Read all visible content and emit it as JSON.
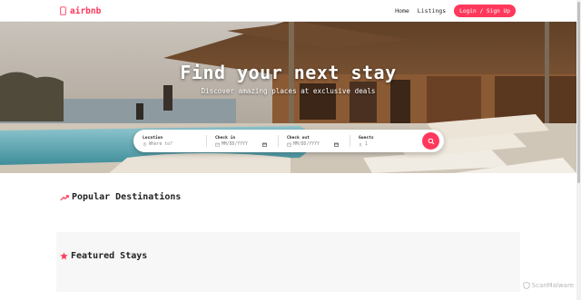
{
  "header": {
    "brand": "airbnb",
    "nav": {
      "home": "Home",
      "listings": "Listings",
      "login": "Login / Sign Up"
    }
  },
  "hero": {
    "title": "Find your next stay",
    "subtitle": "Discover amazing places at exclusive deals"
  },
  "search": {
    "location": {
      "label": "Location",
      "placeholder": "Where to?"
    },
    "checkin": {
      "label": "Check in",
      "value": "MM/DD/YYYY"
    },
    "checkout": {
      "label": "Check out",
      "value": "MM/DD/YYYY"
    },
    "guests": {
      "label": "Guests",
      "value": "1"
    }
  },
  "sections": {
    "popular": "Popular Destinations",
    "featured": "Featured Stays"
  },
  "watermark": "ScanMalware",
  "colors": {
    "brand": "#ff385c",
    "text": "#222222",
    "muted": "#888888"
  },
  "icons": {
    "brand": "airbnb-logo-icon",
    "location": "map-pin-icon",
    "calendar": "calendar-icon",
    "guests": "users-icon",
    "search": "search-icon",
    "popular": "trending-up-icon",
    "featured": "star-icon"
  }
}
